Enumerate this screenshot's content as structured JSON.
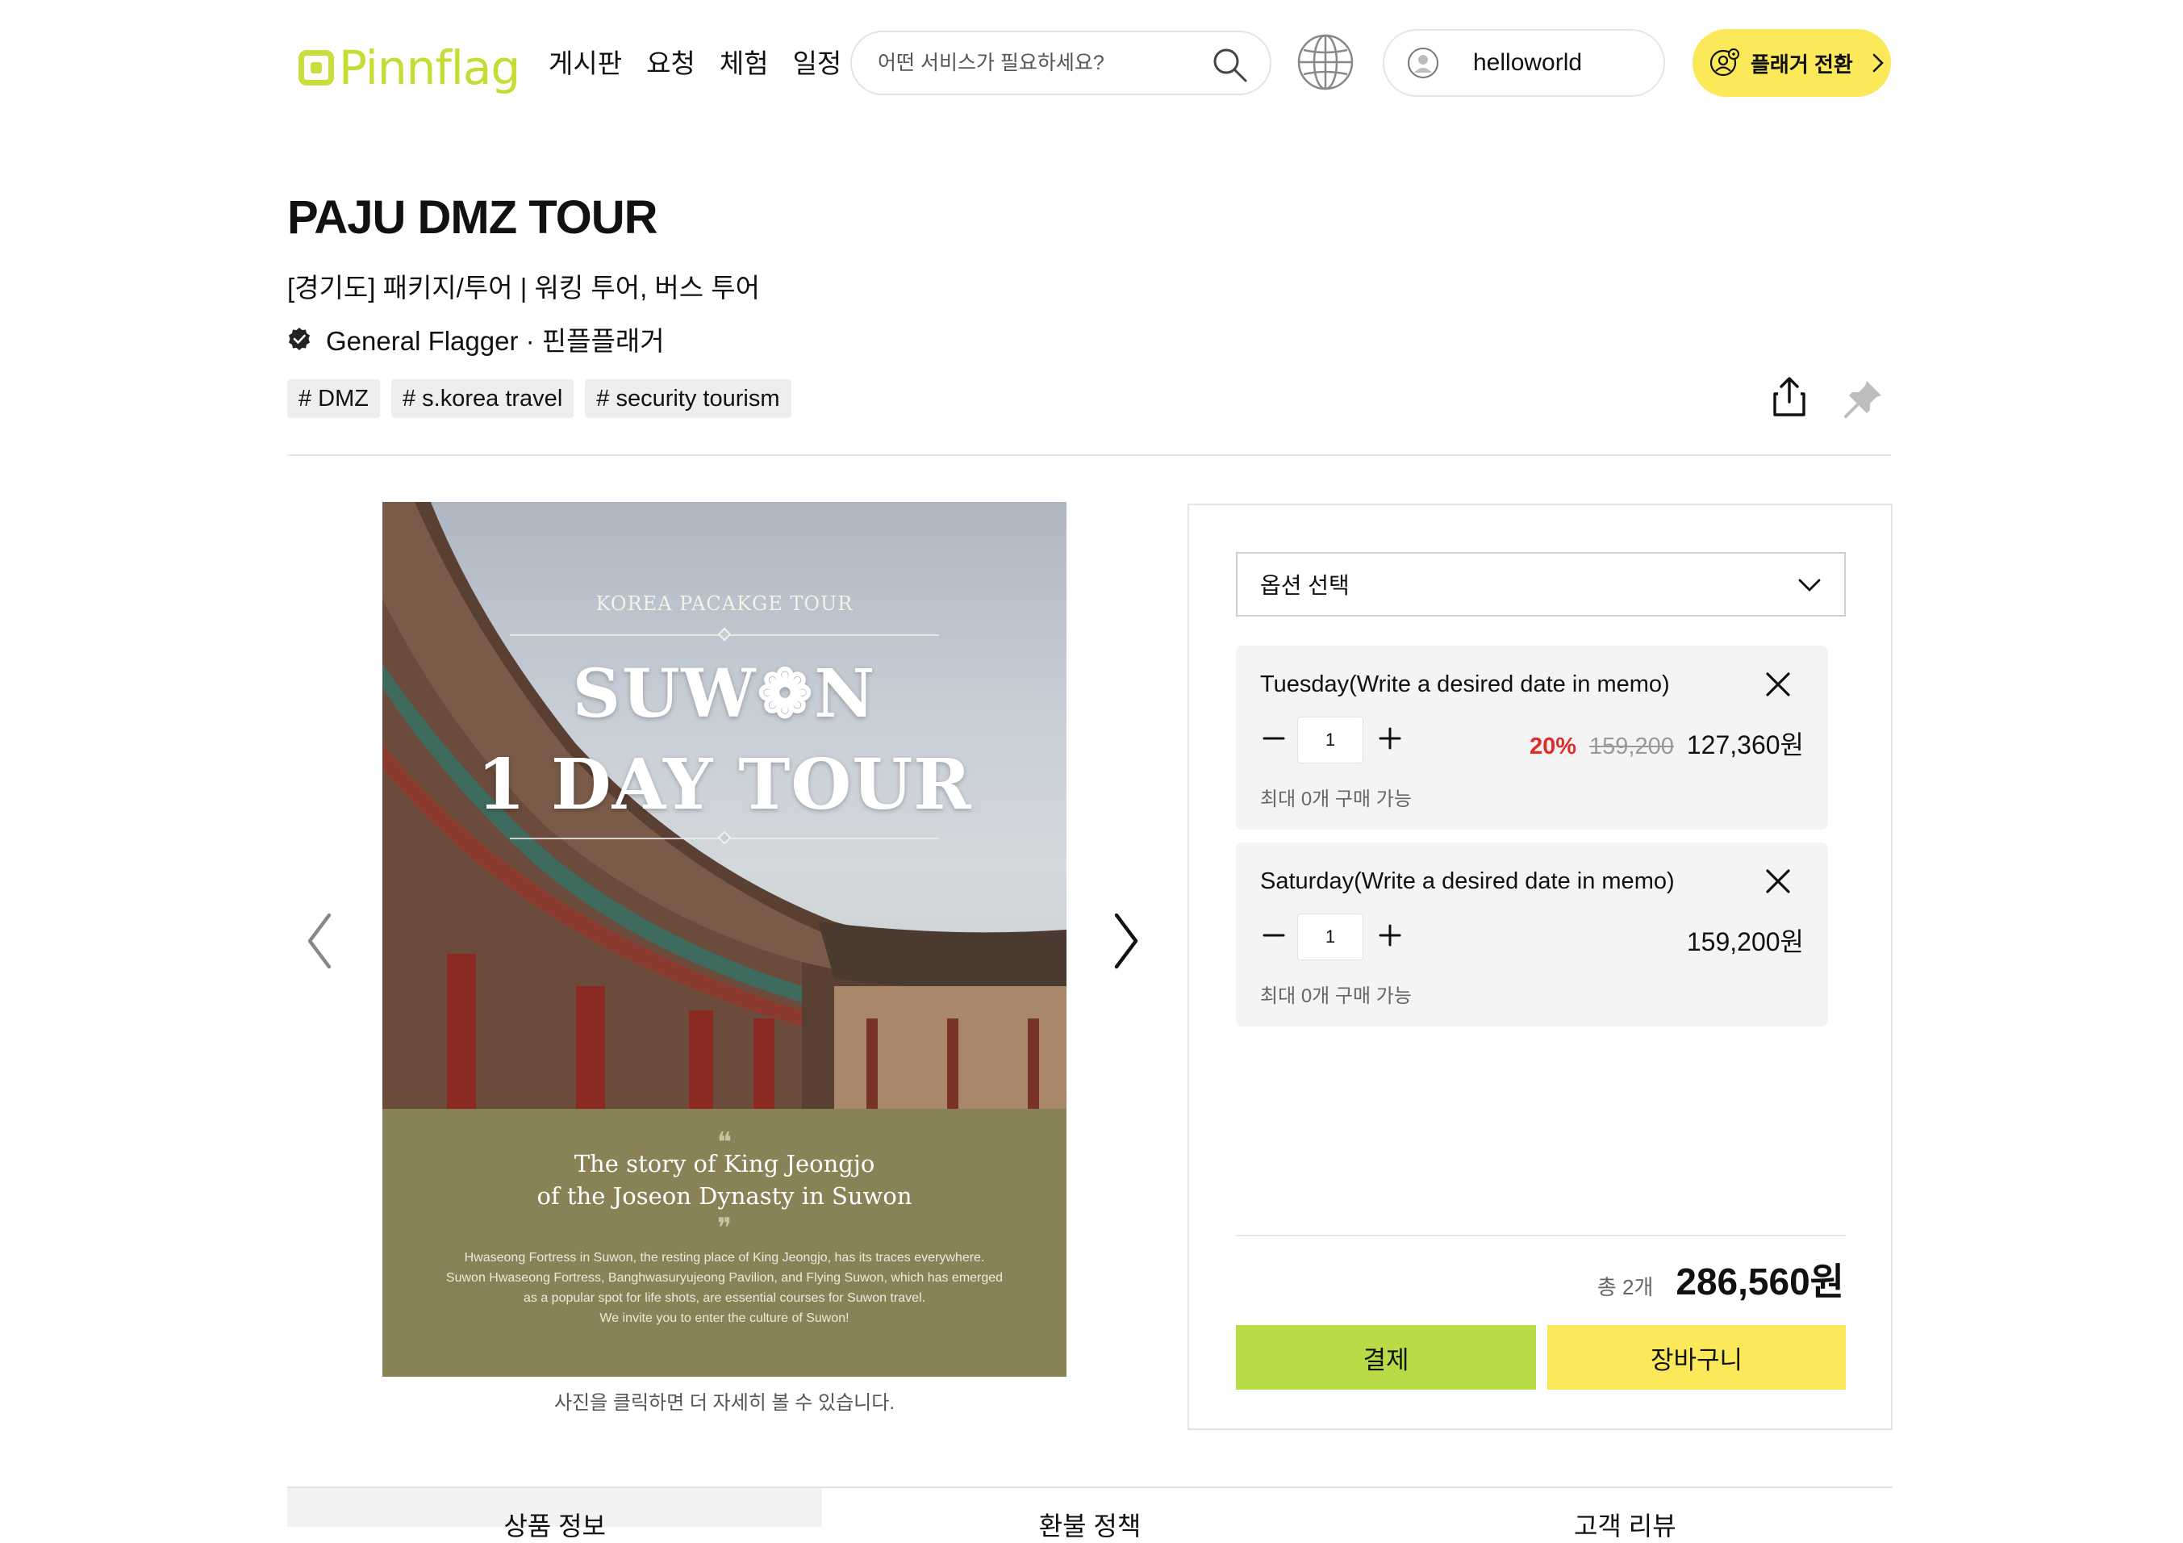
{
  "header": {
    "logo_text": "Pinnflag",
    "nav": [
      "게시판",
      "요청",
      "체험",
      "일정"
    ],
    "search_placeholder": "어떤 서비스가 필요하세요?",
    "username": "helloworld",
    "switch_label": "플래거 전환"
  },
  "product": {
    "title": "PAJU DMZ TOUR",
    "subtitle": "[경기도]  패키지/투어  |  워킹 투어, 버스 투어",
    "flagger": "General Flagger · 핀플플래거",
    "tags": [
      "# DMZ",
      "# s.korea travel",
      "# security tourism"
    ]
  },
  "photo": {
    "eyebrow": "KOREA PACAKGE TOUR",
    "headline1": "SUW❁N",
    "headline2": "1 DAY TOUR",
    "story_line1": "The story of King Jeongjo",
    "story_line2": "of the Joseon Dynasty in Suwon",
    "body_line1": "Hwaseong Fortress in Suwon, the resting place of King Jeongjo, has its traces everywhere.",
    "body_line2": "Suwon Hwaseong Fortress, Banghwasuryujeong Pavilion, and Flying Suwon, which has emerged",
    "body_line3": "as a popular spot for life shots, are essential courses for Suwon travel.",
    "body_line4": "We invite you to enter the culture of Suwon!",
    "caption": "사진을 클릭하면 더 자세히 볼 수 있습니다."
  },
  "panel": {
    "select_label": "옵션 선택",
    "options": [
      {
        "name": "Tuesday(Write a desired date in memo)",
        "qty": "1",
        "discount": "20%",
        "original_price": "159,200",
        "price": "127,360원",
        "max_note": "최대 0개 구매 가능"
      },
      {
        "name": "Saturday(Write a desired date in memo)",
        "qty": "1",
        "price": "159,200원",
        "max_note": "최대 0개 구매 가능"
      }
    ],
    "total_count": "총 2개",
    "total_price": "286,560원",
    "pay_label": "결제",
    "cart_label": "장바구니"
  },
  "tabs": [
    "상품 정보",
    "환불 정책",
    "고객 리뷰"
  ],
  "colors": {
    "brand_green": "#c6dc33",
    "brand_yellow": "#fbe95a",
    "pay_green": "#b8dc48",
    "discount_red": "#e02b2b"
  }
}
